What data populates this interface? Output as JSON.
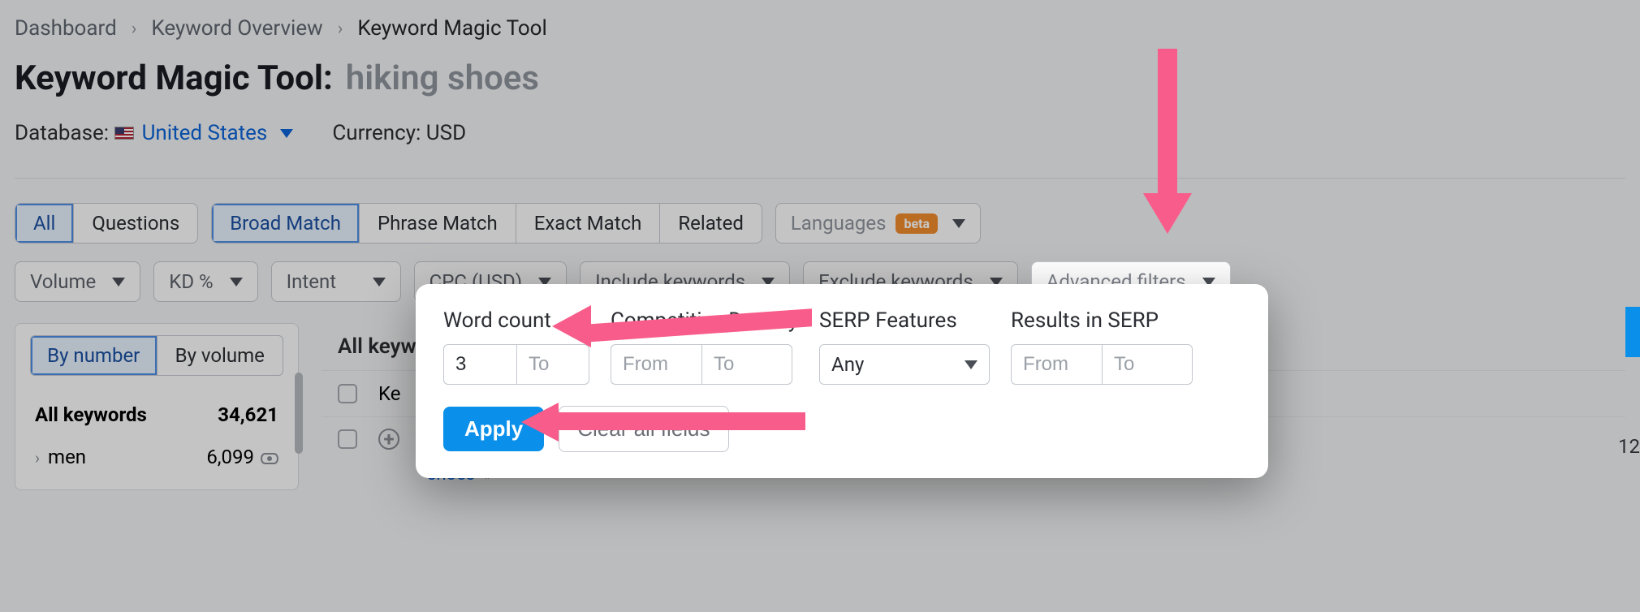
{
  "breadcrumb": {
    "a": "Dashboard",
    "b": "Keyword Overview",
    "c": "Keyword Magic Tool"
  },
  "title": {
    "label": "Keyword Magic Tool:",
    "query": "hiking shoes"
  },
  "db": {
    "label": "Database:",
    "country": "United States"
  },
  "currency": {
    "label": "Currency:",
    "value": "USD"
  },
  "tabs1": {
    "all": "All",
    "questions": "Questions"
  },
  "tabs2": {
    "broad": "Broad Match",
    "phrase": "Phrase Match",
    "exact": "Exact Match",
    "related": "Related"
  },
  "lang": {
    "label": "Languages",
    "badge": "beta"
  },
  "filters": {
    "volume": "Volume",
    "kd": "KD %",
    "intent": "Intent",
    "cpc": "CPC (USD)",
    "include": "Include keywords",
    "exclude": "Exclude keywords",
    "advanced": "Advanced filters"
  },
  "side": {
    "by_number": "By number",
    "by_volume": "By volume",
    "allkw_label": "All keywords",
    "allkw_count": "34,621",
    "row1_label": "men",
    "row1_count": "6,099"
  },
  "main": {
    "header": "All keyw",
    "col_k_partial": "Ke",
    "chip": "shoes",
    "chip_chev": "»",
    "edge_num": "12"
  },
  "popover": {
    "col1_label": "Word count",
    "col1_from": "3",
    "col1_to_ph": "To",
    "col2_label": "Competitive Density",
    "col2_from_ph": "From",
    "col2_to_ph": "To",
    "col3_label": "SERP Features",
    "col3_val": "Any",
    "col4_label": "Results in SERP",
    "col4_from_ph": "From",
    "col4_to_ph": "To",
    "apply": "Apply",
    "clear": "Clear all fields"
  }
}
